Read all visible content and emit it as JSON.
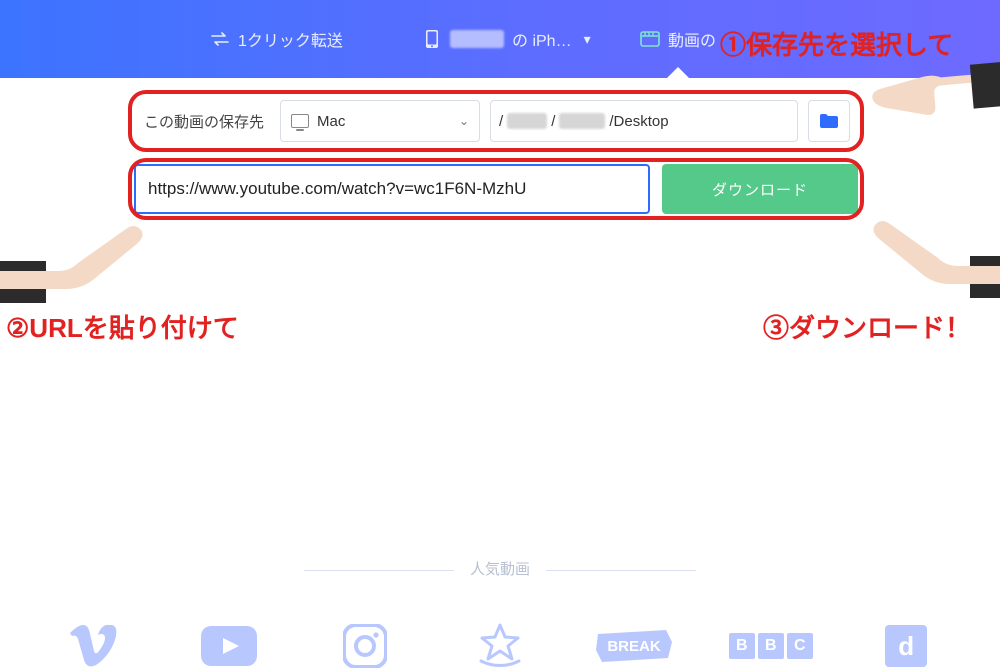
{
  "topbar": {
    "tab1": {
      "label": "1クリック転送"
    },
    "tab2": {
      "suffix": " の iPh…"
    },
    "tab3": {
      "prefix": "動画の"
    }
  },
  "save": {
    "label": "この動画の保存先",
    "device": "Mac",
    "path_tail": "/Desktop"
  },
  "url": {
    "value": "https://www.youtube.com/watch?v=wc1F6N-MzhU"
  },
  "buttons": {
    "download": "ダウンロード"
  },
  "annotations": {
    "step1": "①保存先を選択して",
    "step2": "②URLを貼り付けて",
    "step3": "③ダウンロード！"
  },
  "popular": {
    "label": "人気動画",
    "bbc_b": "B",
    "bbc_c": "C",
    "d": "d"
  }
}
